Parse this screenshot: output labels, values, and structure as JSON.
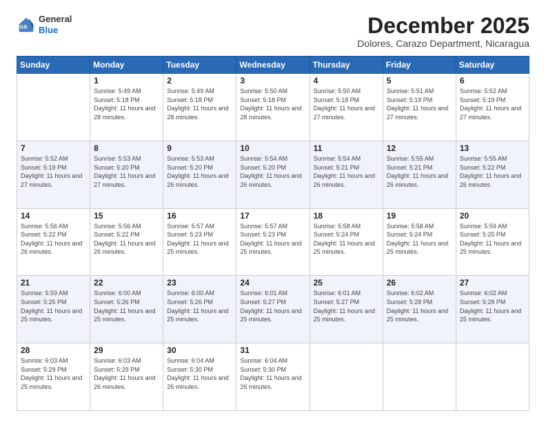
{
  "header": {
    "logo": {
      "general": "General",
      "blue": "Blue"
    },
    "title": "December 2025",
    "location": "Dolores, Carazo Department, Nicaragua"
  },
  "weekdays": [
    "Sunday",
    "Monday",
    "Tuesday",
    "Wednesday",
    "Thursday",
    "Friday",
    "Saturday"
  ],
  "weeks": [
    [
      {
        "day": "",
        "sunrise": "",
        "sunset": "",
        "daylight": ""
      },
      {
        "day": "1",
        "sunrise": "Sunrise: 5:49 AM",
        "sunset": "Sunset: 5:18 PM",
        "daylight": "Daylight: 11 hours and 28 minutes."
      },
      {
        "day": "2",
        "sunrise": "Sunrise: 5:49 AM",
        "sunset": "Sunset: 5:18 PM",
        "daylight": "Daylight: 11 hours and 28 minutes."
      },
      {
        "day": "3",
        "sunrise": "Sunrise: 5:50 AM",
        "sunset": "Sunset: 5:18 PM",
        "daylight": "Daylight: 11 hours and 28 minutes."
      },
      {
        "day": "4",
        "sunrise": "Sunrise: 5:50 AM",
        "sunset": "Sunset: 5:18 PM",
        "daylight": "Daylight: 11 hours and 27 minutes."
      },
      {
        "day": "5",
        "sunrise": "Sunrise: 5:51 AM",
        "sunset": "Sunset: 5:19 PM",
        "daylight": "Daylight: 11 hours and 27 minutes."
      },
      {
        "day": "6",
        "sunrise": "Sunrise: 5:52 AM",
        "sunset": "Sunset: 5:19 PM",
        "daylight": "Daylight: 11 hours and 27 minutes."
      }
    ],
    [
      {
        "day": "7",
        "sunrise": "Sunrise: 5:52 AM",
        "sunset": "Sunset: 5:19 PM",
        "daylight": "Daylight: 11 hours and 27 minutes."
      },
      {
        "day": "8",
        "sunrise": "Sunrise: 5:53 AM",
        "sunset": "Sunset: 5:20 PM",
        "daylight": "Daylight: 11 hours and 27 minutes."
      },
      {
        "day": "9",
        "sunrise": "Sunrise: 5:53 AM",
        "sunset": "Sunset: 5:20 PM",
        "daylight": "Daylight: 11 hours and 26 minutes."
      },
      {
        "day": "10",
        "sunrise": "Sunrise: 5:54 AM",
        "sunset": "Sunset: 5:20 PM",
        "daylight": "Daylight: 11 hours and 26 minutes."
      },
      {
        "day": "11",
        "sunrise": "Sunrise: 5:54 AM",
        "sunset": "Sunset: 5:21 PM",
        "daylight": "Daylight: 11 hours and 26 minutes."
      },
      {
        "day": "12",
        "sunrise": "Sunrise: 5:55 AM",
        "sunset": "Sunset: 5:21 PM",
        "daylight": "Daylight: 11 hours and 26 minutes."
      },
      {
        "day": "13",
        "sunrise": "Sunrise: 5:55 AM",
        "sunset": "Sunset: 5:22 PM",
        "daylight": "Daylight: 11 hours and 26 minutes."
      }
    ],
    [
      {
        "day": "14",
        "sunrise": "Sunrise: 5:56 AM",
        "sunset": "Sunset: 5:22 PM",
        "daylight": "Daylight: 11 hours and 26 minutes."
      },
      {
        "day": "15",
        "sunrise": "Sunrise: 5:56 AM",
        "sunset": "Sunset: 5:22 PM",
        "daylight": "Daylight: 11 hours and 26 minutes."
      },
      {
        "day": "16",
        "sunrise": "Sunrise: 5:57 AM",
        "sunset": "Sunset: 5:23 PM",
        "daylight": "Daylight: 11 hours and 25 minutes."
      },
      {
        "day": "17",
        "sunrise": "Sunrise: 5:57 AM",
        "sunset": "Sunset: 5:23 PM",
        "daylight": "Daylight: 11 hours and 25 minutes."
      },
      {
        "day": "18",
        "sunrise": "Sunrise: 5:58 AM",
        "sunset": "Sunset: 5:24 PM",
        "daylight": "Daylight: 11 hours and 25 minutes."
      },
      {
        "day": "19",
        "sunrise": "Sunrise: 5:58 AM",
        "sunset": "Sunset: 5:24 PM",
        "daylight": "Daylight: 11 hours and 25 minutes."
      },
      {
        "day": "20",
        "sunrise": "Sunrise: 5:59 AM",
        "sunset": "Sunset: 5:25 PM",
        "daylight": "Daylight: 11 hours and 25 minutes."
      }
    ],
    [
      {
        "day": "21",
        "sunrise": "Sunrise: 5:59 AM",
        "sunset": "Sunset: 5:25 PM",
        "daylight": "Daylight: 11 hours and 25 minutes."
      },
      {
        "day": "22",
        "sunrise": "Sunrise: 6:00 AM",
        "sunset": "Sunset: 5:26 PM",
        "daylight": "Daylight: 11 hours and 25 minutes."
      },
      {
        "day": "23",
        "sunrise": "Sunrise: 6:00 AM",
        "sunset": "Sunset: 5:26 PM",
        "daylight": "Daylight: 11 hours and 25 minutes."
      },
      {
        "day": "24",
        "sunrise": "Sunrise: 6:01 AM",
        "sunset": "Sunset: 5:27 PM",
        "daylight": "Daylight: 11 hours and 25 minutes."
      },
      {
        "day": "25",
        "sunrise": "Sunrise: 6:01 AM",
        "sunset": "Sunset: 5:27 PM",
        "daylight": "Daylight: 11 hours and 25 minutes."
      },
      {
        "day": "26",
        "sunrise": "Sunrise: 6:02 AM",
        "sunset": "Sunset: 5:28 PM",
        "daylight": "Daylight: 11 hours and 25 minutes."
      },
      {
        "day": "27",
        "sunrise": "Sunrise: 6:02 AM",
        "sunset": "Sunset: 5:28 PM",
        "daylight": "Daylight: 11 hours and 25 minutes."
      }
    ],
    [
      {
        "day": "28",
        "sunrise": "Sunrise: 6:03 AM",
        "sunset": "Sunset: 5:29 PM",
        "daylight": "Daylight: 11 hours and 25 minutes."
      },
      {
        "day": "29",
        "sunrise": "Sunrise: 6:03 AM",
        "sunset": "Sunset: 5:29 PM",
        "daylight": "Daylight: 11 hours and 26 minutes."
      },
      {
        "day": "30",
        "sunrise": "Sunrise: 6:04 AM",
        "sunset": "Sunset: 5:30 PM",
        "daylight": "Daylight: 11 hours and 26 minutes."
      },
      {
        "day": "31",
        "sunrise": "Sunrise: 6:04 AM",
        "sunset": "Sunset: 5:30 PM",
        "daylight": "Daylight: 11 hours and 26 minutes."
      },
      {
        "day": "",
        "sunrise": "",
        "sunset": "",
        "daylight": ""
      },
      {
        "day": "",
        "sunrise": "",
        "sunset": "",
        "daylight": ""
      },
      {
        "day": "",
        "sunrise": "",
        "sunset": "",
        "daylight": ""
      }
    ]
  ]
}
